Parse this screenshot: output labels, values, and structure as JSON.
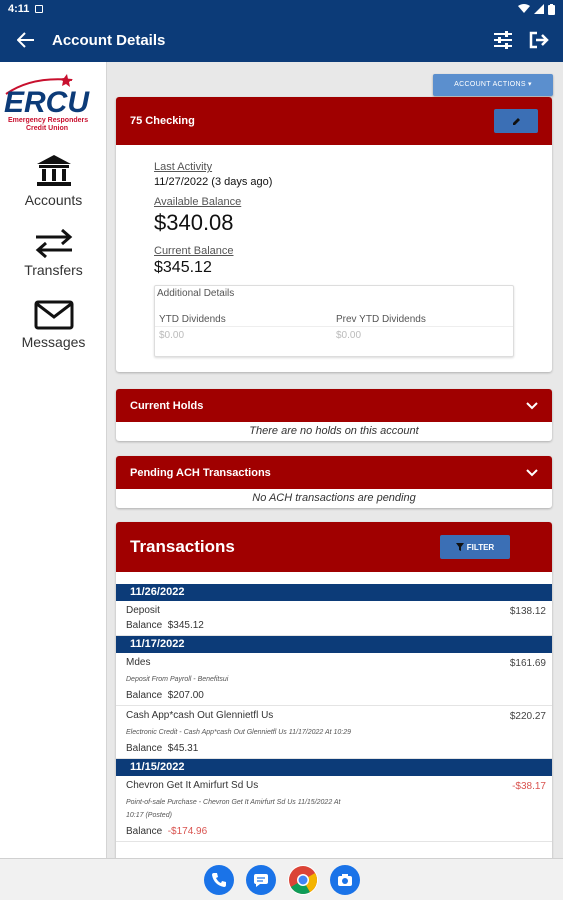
{
  "status_bar": {
    "time": "4:11"
  },
  "app_bar": {
    "title": "Account Details"
  },
  "logo": {
    "name": "ERCU",
    "tagline_1": "Emergency Responders",
    "tagline_2": "Credit Union"
  },
  "sidebar": {
    "items": [
      {
        "label": "Accounts"
      },
      {
        "label": "Transfers"
      },
      {
        "label": "Messages"
      }
    ]
  },
  "account_actions_label": "ACCOUNT ACTIONS ▾",
  "account": {
    "name": "75 Checking",
    "last_activity_label": "Last Activity",
    "last_activity_value": "11/27/2022  (3 days ago)",
    "available_balance_label": "Available Balance",
    "available_balance": "$340.08",
    "current_balance_label": "Current Balance",
    "current_balance": "$345.12",
    "additional_details": {
      "title": "Additional Details",
      "ytd_label": "YTD Dividends",
      "ytd_value": "$0.00",
      "prev_ytd_label": "Prev YTD Dividends",
      "prev_ytd_value": "$0.00"
    }
  },
  "current_holds": {
    "title": "Current Holds",
    "message": "There are no holds on this account"
  },
  "pending_ach": {
    "title": "Pending ACH Transactions",
    "message": "No ACH transactions are pending"
  },
  "transactions": {
    "title": "Transactions",
    "filter_label": "FILTER",
    "groups": [
      {
        "date": "11/26/2022",
        "items": [
          {
            "desc": "Deposit",
            "amount": "$138.12",
            "memo": "",
            "balance_label": "Balance",
            "balance": "$345.12"
          }
        ]
      },
      {
        "date": "11/17/2022",
        "items": [
          {
            "desc": "Mdes",
            "amount": "$161.69",
            "memo": "Deposit From Payroll - Benefitsui",
            "balance_label": "Balance",
            "balance": "$207.00"
          },
          {
            "desc": "Cash App*cash Out Glennietfl Us",
            "amount": "$220.27",
            "memo": "Electronic Credit - Cash App*cash Out Glennietfl Us 11/17/2022 At 10:29",
            "balance_label": "Balance",
            "balance": "$45.31"
          }
        ]
      },
      {
        "date": "11/15/2022",
        "items": [
          {
            "desc": "Chevron Get It Amirfurt Sd Us",
            "amount": "-$38.17",
            "memo": "Point-of-sale Purchase - Chevron Get It Amirfurt Sd Us 11/15/2022 At",
            "memo2": "10:17 (Posted)",
            "balance_label": "Balance",
            "balance": "-$174.96"
          }
        ]
      }
    ]
  }
}
